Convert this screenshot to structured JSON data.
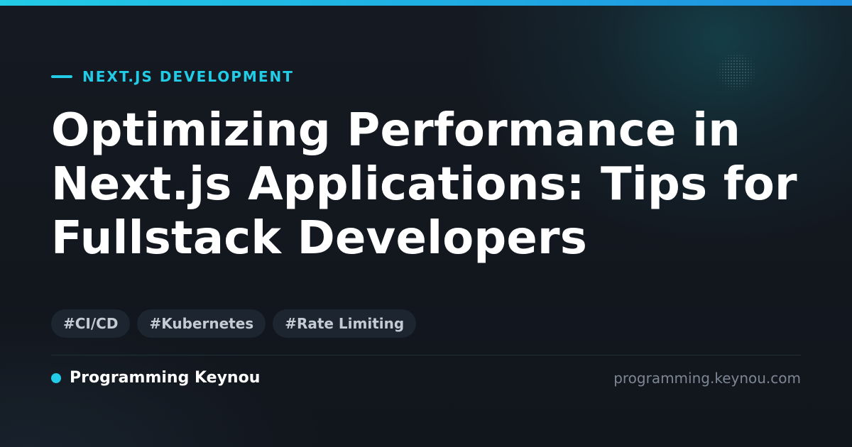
{
  "category": {
    "label": "NEXT.JS DEVELOPMENT"
  },
  "title": "Optimizing Performance in Next.js Applications: Tips for Fullstack Developers",
  "tags": [
    "#CI/CD",
    "#Kubernetes",
    "#Rate Limiting"
  ],
  "footer": {
    "brand_name": "Programming Keynou",
    "site_url": "programming.keynou.com"
  },
  "colors": {
    "accent": "#22cbe6",
    "background": "#131720",
    "tag_background": "#1c2530",
    "muted_text": "#7d8794"
  }
}
